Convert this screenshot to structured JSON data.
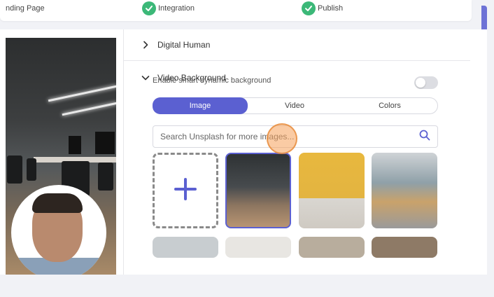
{
  "steps": [
    {
      "label": "nding Page"
    },
    {
      "label": "Integration"
    },
    {
      "label": "Publish"
    }
  ],
  "sections": {
    "digital_human": "Digital Human",
    "video_background": "Video Background"
  },
  "toggle": {
    "label": "Enable smart dynamic background",
    "enabled": false
  },
  "tabs": [
    {
      "label": "Image",
      "active": true
    },
    {
      "label": "Video",
      "active": false
    },
    {
      "label": "Colors",
      "active": false
    }
  ],
  "search": {
    "placeholder": "Search Unsplash for more images..."
  },
  "icons": {
    "check": "check-circle-icon",
    "chevron_right": "chevron-right-icon",
    "chevron_down": "chevron-down-icon",
    "search": "search-icon",
    "add": "plus-icon"
  },
  "colors": {
    "accent": "#5b60d1",
    "success": "#3cb878"
  }
}
